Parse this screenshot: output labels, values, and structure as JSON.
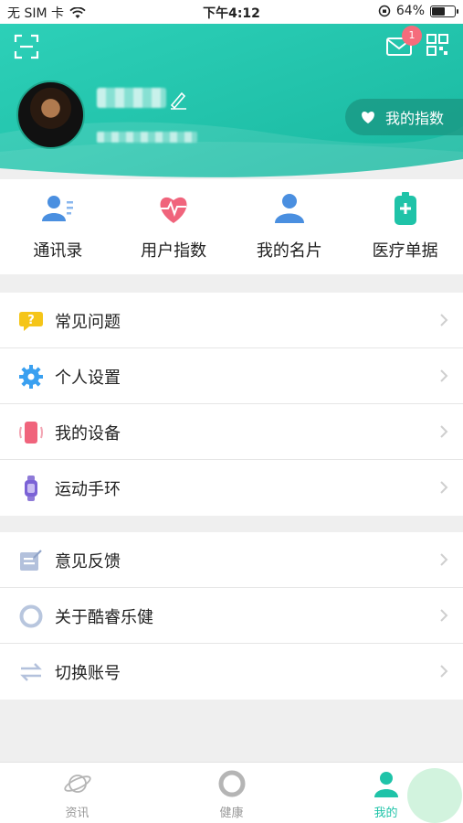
{
  "status_bar": {
    "carrier": "无 SIM 卡",
    "time": "下午4:12",
    "battery_percent": "64%",
    "battery_level": 0.64
  },
  "header": {
    "mail_badge_count": "1",
    "index_button_label": "我的指数"
  },
  "quick_actions": [
    {
      "label": "通讯录",
      "icon": "contacts-icon"
    },
    {
      "label": "用户指数",
      "icon": "heart-rate-icon"
    },
    {
      "label": "我的名片",
      "icon": "profile-card-icon"
    },
    {
      "label": "医疗单据",
      "icon": "medical-record-icon"
    }
  ],
  "menu_group_1": [
    {
      "label": "常见问题",
      "icon": "faq-icon"
    },
    {
      "label": "个人设置",
      "icon": "settings-gear-icon"
    },
    {
      "label": "我的设备",
      "icon": "device-icon"
    },
    {
      "label": "运动手环",
      "icon": "wristband-icon"
    }
  ],
  "menu_group_2": [
    {
      "label": "意见反馈",
      "icon": "feedback-icon"
    },
    {
      "label": "关于酷睿乐健",
      "icon": "about-ring-icon"
    },
    {
      "label": "切换账号",
      "icon": "switch-account-icon"
    }
  ],
  "tab_bar": [
    {
      "label": "资讯",
      "icon": "planet-icon",
      "active": false
    },
    {
      "label": "健康",
      "icon": "health-ring-icon",
      "active": false
    },
    {
      "label": "我的",
      "icon": "user-icon",
      "active": true
    }
  ],
  "colors": {
    "brand": "#26c9b0",
    "active_tab": "#1fc3a8",
    "badge": "#f56c7c"
  }
}
